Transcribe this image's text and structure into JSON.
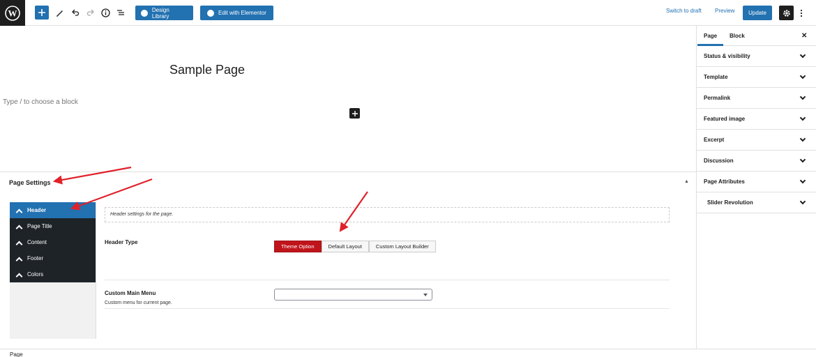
{
  "toolbar": {
    "design_library_label": "Design Library",
    "edit_elementor_label": "Edit with Elementor",
    "switch_to_draft_label": "Switch to draft",
    "preview_label": "Preview",
    "update_label": "Update"
  },
  "editor": {
    "title": "Sample Page",
    "block_placeholder": "Type / to choose a block"
  },
  "page_settings": {
    "title": "Page Settings",
    "tabs": [
      {
        "label": "Header"
      },
      {
        "label": "Page Title"
      },
      {
        "label": "Content"
      },
      {
        "label": "Footer"
      },
      {
        "label": "Colors"
      }
    ],
    "description": "Header settings for the page.",
    "header_type": {
      "label": "Header Type",
      "options": [
        "Theme Option",
        "Default Layout",
        "Custom Layout Builder"
      ],
      "selected": "Theme Option"
    },
    "custom_menu": {
      "label": "Custom Main Menu",
      "sublabel": "Custom menu for current page.",
      "value": ""
    }
  },
  "sidebar": {
    "tabs": [
      {
        "label": "Page"
      },
      {
        "label": "Block"
      }
    ],
    "panels": [
      {
        "label": "Status & visibility"
      },
      {
        "label": "Template"
      },
      {
        "label": "Permalink"
      },
      {
        "label": "Featured image"
      },
      {
        "label": "Excerpt"
      },
      {
        "label": "Discussion"
      },
      {
        "label": "Page Attributes"
      },
      {
        "label": "Slider Revolution"
      }
    ]
  },
  "footer": {
    "breadcrumb": "Page"
  },
  "colors": {
    "accent": "#2271b1",
    "dark": "#1e1e1e",
    "selected_option": "#c0141b",
    "annotation_arrow": "#e0212a"
  }
}
